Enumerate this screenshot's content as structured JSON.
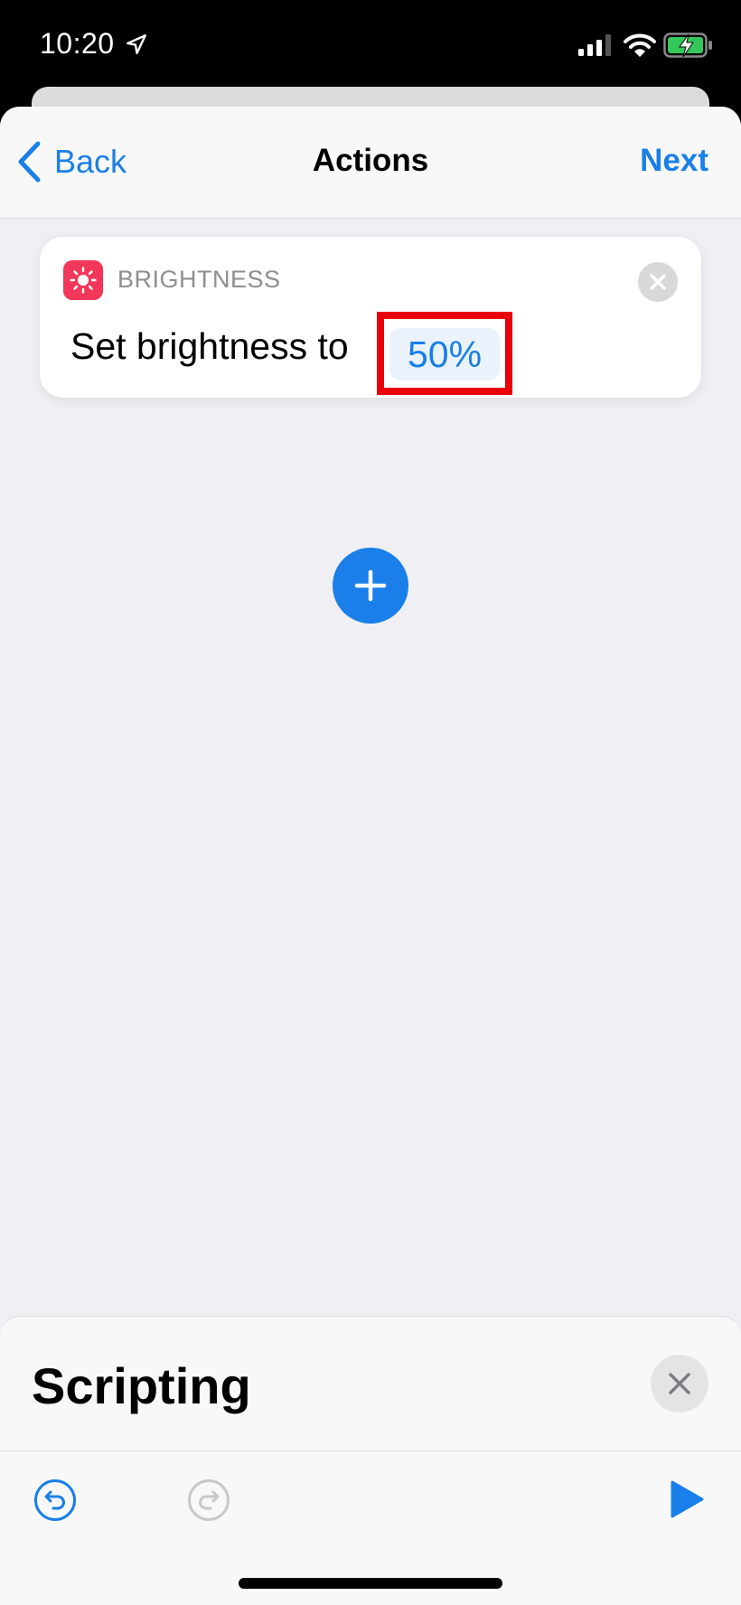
{
  "status_bar": {
    "time": "10:20",
    "icons": [
      "location-arrow-icon",
      "cellular-signal-icon",
      "wifi-icon",
      "battery-charging-icon"
    ]
  },
  "nav": {
    "back_label": "Back",
    "title": "Actions",
    "next_label": "Next"
  },
  "action": {
    "app_icon": "sun-brightness-icon",
    "category": "BRIGHTNESS",
    "sentence": "Set brightness to",
    "value": "50%",
    "remove_icon": "close-icon"
  },
  "add_action": {
    "icon": "plus-icon"
  },
  "bottom_sheet": {
    "title": "Scripting",
    "close_icon": "close-icon"
  },
  "toolbar": {
    "undo_icon": "undo-icon",
    "redo_icon": "redo-icon",
    "run_icon": "play-icon"
  },
  "colors": {
    "accent": "#1a7fe8",
    "brightness_app": "#f2385a",
    "highlight": "#e8000b"
  }
}
